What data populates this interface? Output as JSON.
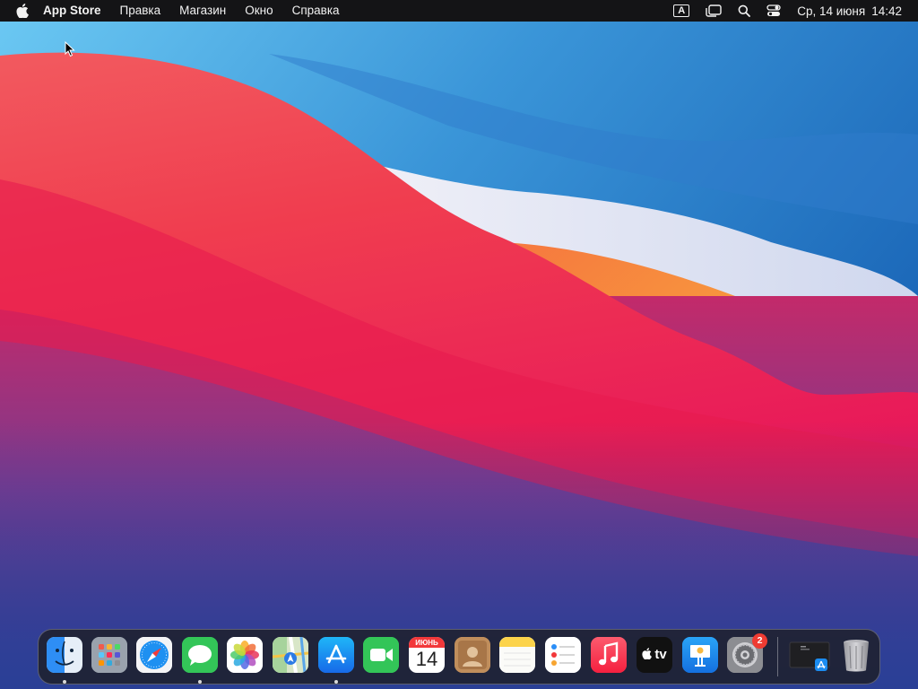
{
  "menubar": {
    "apple_icon": "apple-logo-icon",
    "app_name": "App Store",
    "menus": [
      "Правка",
      "Магазин",
      "Окно",
      "Справка"
    ],
    "input_source": "A",
    "date": "Ср, 14 июня",
    "time": "14:42"
  },
  "dock": {
    "apps": [
      {
        "name": "Finder",
        "icon": "finder-icon",
        "running": true
      },
      {
        "name": "Launchpad",
        "icon": "launchpad-icon",
        "running": false
      },
      {
        "name": "Safari",
        "icon": "safari-icon",
        "running": false
      },
      {
        "name": "Сообщения",
        "icon": "messages-icon",
        "running": true
      },
      {
        "name": "Фото",
        "icon": "photos-icon",
        "running": false
      },
      {
        "name": "Карты",
        "icon": "maps-icon",
        "running": false
      },
      {
        "name": "App Store",
        "icon": "app-store-icon",
        "running": true
      },
      {
        "name": "FaceTime",
        "icon": "facetime-icon",
        "running": false
      },
      {
        "name": "Календарь",
        "icon": "calendar-icon",
        "running": false
      },
      {
        "name": "Контакты",
        "icon": "contacts-icon",
        "running": false
      },
      {
        "name": "Заметки",
        "icon": "notes-icon",
        "running": false
      },
      {
        "name": "Напоминания",
        "icon": "reminders-icon",
        "running": false
      },
      {
        "name": "Музыка",
        "icon": "music-icon",
        "running": false
      },
      {
        "name": "TV",
        "icon": "tv-icon",
        "running": false
      },
      {
        "name": "Keynote",
        "icon": "keynote-icon",
        "running": false
      },
      {
        "name": "Системные настройки",
        "icon": "settings-icon",
        "running": false
      }
    ],
    "calendar_month": "ИЮНЬ",
    "calendar_day": "14",
    "tv_label": "tv",
    "settings_badge": "2",
    "recent": {
      "name": "App Store window",
      "icon": "recent-window-icon"
    },
    "trash": {
      "name": "Корзина",
      "icon": "trash-icon"
    }
  },
  "colors": {
    "menubar_bg": "#141416",
    "wallpaper_blue": "#1b6fc2",
    "wallpaper_red": "#f2334e",
    "wallpaper_orange": "#f6a13a",
    "badge_red": "#ef3b32"
  }
}
